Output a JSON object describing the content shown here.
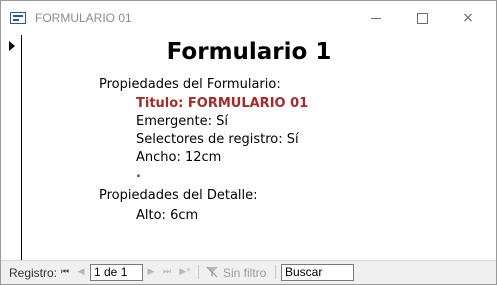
{
  "window": {
    "title": "FORMULARIO 01",
    "icon": "form-icon",
    "controls": {
      "minimize": "minimize-icon",
      "maximize": "maximize-icon",
      "close": "×"
    }
  },
  "form": {
    "title": "Formulario 1",
    "sections": [
      {
        "heading": "Propiedades del Formulario:",
        "items": [
          {
            "text": "Titulo: FORMULARIO 01",
            "highlight": true
          },
          {
            "text": "Emergente: Sí",
            "highlight": false
          },
          {
            "text": "Selectores de registro: Sí",
            "highlight": false
          },
          {
            "text": "Ancho: 12cm",
            "highlight": false
          },
          {
            "text": ".",
            "highlight": true
          }
        ]
      },
      {
        "heading": "Propiedades del Detalle:",
        "items": [
          {
            "text": "Alto: 6cm",
            "highlight": false
          }
        ]
      }
    ],
    "highlight_color": "#a52a2a"
  },
  "navigation": {
    "label": "Registro:",
    "first": "⏮",
    "prev": "◀",
    "record_value": "1 de 1",
    "next": "▶",
    "last": "⏭",
    "new": "▶*",
    "filter_label": "Sin filtro",
    "search_value": "Buscar"
  }
}
